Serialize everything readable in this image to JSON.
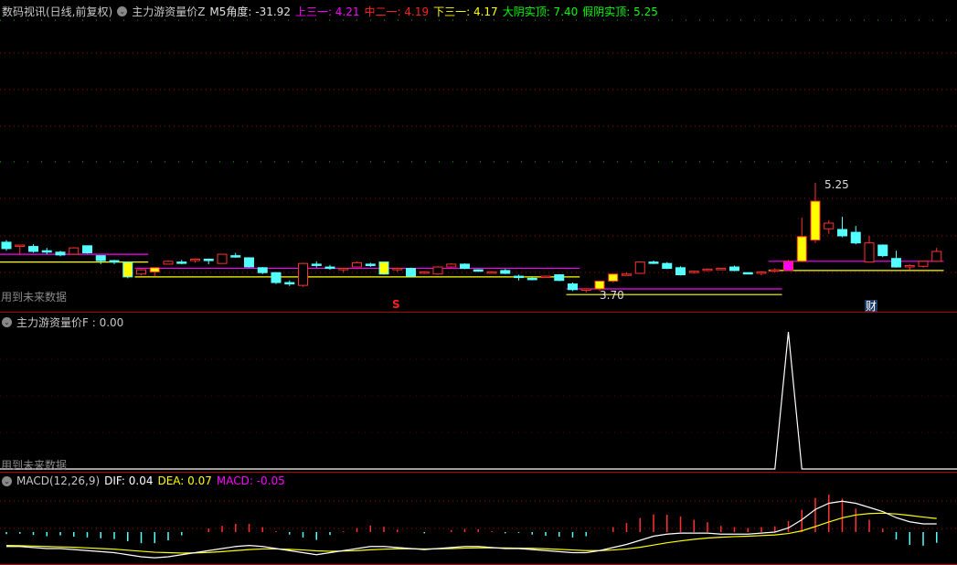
{
  "main_panel": {
    "title": "数码视讯(日线,前复权)",
    "indicator": "主力游资量价Z",
    "m5_angle": "M5角度: -31.92",
    "upper": "上三一: 4.21",
    "middle": "中二一: 4.19",
    "lower": "下三一: 4.17",
    "big_yin": "大阴实顶: 7.40",
    "fake_yin": "假阴实顶: 5.25",
    "future_warning": "用到未来数据",
    "high_label": "5.25",
    "low_label": "3.70",
    "marker_s": "S",
    "marker_cai": "财",
    "colors": {
      "up": "#ff3030",
      "down": "#54ffff",
      "upper": "#ff00ff",
      "middle": "#ff2020",
      "lower": "#ffff00",
      "big_yin": "#00ff00",
      "fake_yin": "#00ff00"
    }
  },
  "sub_panel": {
    "title": "主力游资量价F : 0.00",
    "future_warning": "用到未来数据"
  },
  "macd_panel": {
    "title": "MACD(12,26,9)",
    "dif": "DIF: 0.04",
    "dea": "DEA: 0.07",
    "macd": "MACD: -0.05"
  },
  "chart_data": [
    {
      "type": "candlestick",
      "name": "price",
      "ylim": [
        3.44,
        7.64
      ],
      "candles": [
        [
          4.41,
          4.32,
          4.44,
          4.29
        ],
        [
          4.37,
          4.37,
          4.37,
          4.24
        ],
        [
          4.35,
          4.28,
          4.38,
          4.26
        ],
        [
          4.29,
          4.27,
          4.33,
          4.24
        ],
        [
          4.27,
          4.23,
          4.29,
          4.21
        ],
        [
          4.24,
          4.33,
          4.34,
          4.24
        ],
        [
          4.36,
          4.26,
          4.36,
          4.25
        ],
        [
          4.22,
          4.15,
          4.22,
          4.1
        ],
        [
          4.15,
          4.13,
          4.16,
          4.1
        ],
        [
          4.13,
          3.92,
          4.14,
          3.9
        ],
        [
          3.96,
          4.02,
          4.03,
          3.94
        ],
        [
          3.99,
          4.05,
          4.05,
          3.93
        ],
        [
          4.1,
          4.14,
          4.15,
          4.1
        ],
        [
          4.13,
          4.12,
          4.16,
          4.1
        ],
        [
          4.15,
          4.17,
          4.18,
          4.12
        ],
        [
          4.17,
          4.15,
          4.18,
          4.1
        ],
        [
          4.11,
          4.24,
          4.24,
          4.11
        ],
        [
          4.22,
          4.2,
          4.26,
          4.19
        ],
        [
          4.19,
          4.06,
          4.19,
          4.05
        ],
        [
          4.05,
          3.98,
          4.06,
          3.96
        ],
        [
          3.98,
          3.84,
          3.99,
          3.82
        ],
        [
          3.84,
          3.82,
          3.87,
          3.79
        ],
        [
          3.8,
          4.11,
          4.12,
          3.78
        ],
        [
          4.1,
          4.09,
          4.14,
          4.05
        ],
        [
          4.06,
          4.04,
          4.09,
          4.02
        ],
        [
          4.04,
          4.04,
          4.05,
          3.98
        ],
        [
          4.06,
          4.12,
          4.14,
          4.06
        ],
        [
          4.1,
          4.08,
          4.12,
          4.06
        ],
        [
          4.13,
          3.96,
          4.13,
          3.95
        ],
        [
          4.04,
          4.04,
          4.05,
          3.99
        ],
        [
          4.04,
          3.93,
          4.05,
          3.92
        ],
        [
          3.97,
          3.99,
          4.0,
          3.96
        ],
        [
          3.96,
          4.06,
          4.07,
          3.95
        ],
        [
          4.06,
          4.1,
          4.11,
          4.05
        ],
        [
          4.1,
          4.04,
          4.11,
          4.03
        ],
        [
          4.02,
          4.0,
          4.03,
          3.99
        ],
        [
          3.98,
          3.99,
          4.0,
          3.97
        ],
        [
          4.01,
          3.97,
          4.03,
          3.96
        ],
        [
          3.93,
          3.92,
          3.95,
          3.87
        ],
        [
          3.9,
          3.89,
          3.91,
          3.87
        ],
        [
          3.92,
          3.93,
          3.94,
          3.91
        ],
        [
          3.95,
          3.87,
          3.96,
          3.86
        ],
        [
          3.82,
          3.74,
          3.84,
          3.72
        ],
        [
          3.74,
          3.75,
          3.76,
          3.7
        ],
        [
          3.75,
          3.86,
          3.86,
          3.72
        ],
        [
          3.86,
          3.96,
          3.96,
          3.84
        ],
        [
          3.96,
          3.96,
          3.98,
          3.95
        ],
        [
          3.97,
          4.13,
          4.14,
          3.96
        ],
        [
          4.13,
          4.12,
          4.15,
          4.1
        ],
        [
          4.11,
          4.04,
          4.13,
          4.03
        ],
        [
          4.05,
          3.95,
          4.07,
          3.94
        ],
        [
          3.99,
          4.0,
          4.01,
          3.97
        ],
        [
          4.01,
          4.03,
          4.04,
          4.0
        ],
        [
          4.03,
          4.04,
          4.05,
          4.02
        ],
        [
          4.06,
          4.01,
          4.08,
          4.0
        ],
        [
          3.98,
          3.97,
          3.98,
          3.97
        ],
        [
          3.97,
          3.99,
          4.0,
          3.94
        ],
        [
          4.01,
          4.02,
          4.04,
          3.98
        ],
        [
          4.01,
          4.14,
          4.16,
          4.01
        ],
        [
          4.14,
          4.49,
          4.76,
          4.13
        ],
        [
          4.44,
          4.99,
          5.25,
          4.4
        ],
        [
          4.6,
          4.68,
          4.72,
          4.53
        ],
        [
          4.59,
          4.5,
          4.77,
          4.48
        ],
        [
          4.55,
          4.4,
          4.64,
          4.38
        ],
        [
          4.13,
          4.4,
          4.5,
          4.13
        ],
        [
          4.37,
          4.22,
          4.38,
          4.2
        ],
        [
          4.18,
          4.06,
          4.29,
          4.05
        ],
        [
          4.07,
          4.08,
          4.1,
          4.02
        ],
        [
          4.07,
          4.14,
          4.14,
          4.05
        ],
        [
          4.14,
          4.28,
          4.33,
          4.14
        ]
      ],
      "highlight_yellow": [
        9,
        11,
        28,
        44,
        45,
        59,
        60
      ],
      "highlight_magenta": [
        58
      ],
      "levels": [
        {
          "value": 4.24,
          "color": "#ff00ff",
          "from": 0,
          "to": 11
        },
        {
          "value": 4.13,
          "color": "#ffff00",
          "from": 0,
          "to": 11
        },
        {
          "value": 4.04,
          "color": "#ff00ff",
          "from": 10,
          "to": 43
        },
        {
          "value": 3.92,
          "color": "#ffff00",
          "from": 10,
          "to": 43
        },
        {
          "value": 3.75,
          "color": "#ff00ff",
          "from": 42,
          "to": 58
        },
        {
          "value": 3.67,
          "color": "#ffff00",
          "from": 42,
          "to": 58
        },
        {
          "value": 4.14,
          "color": "#ff00ff",
          "from": 57,
          "to": 70
        },
        {
          "value": 4.01,
          "color": "#ffff00",
          "from": 57,
          "to": 70
        }
      ]
    },
    {
      "type": "line",
      "name": "主力游资量价F",
      "ylim": [
        0,
        1
      ],
      "spike_index": 58,
      "spike_value": 1
    },
    {
      "type": "macd",
      "ylim": [
        -0.16,
        0.24
      ],
      "dif": [
        -0.07,
        -0.07,
        -0.075,
        -0.08,
        -0.08,
        -0.085,
        -0.09,
        -0.095,
        -0.1,
        -0.11,
        -0.12,
        -0.125,
        -0.12,
        -0.11,
        -0.1,
        -0.09,
        -0.08,
        -0.07,
        -0.065,
        -0.07,
        -0.08,
        -0.09,
        -0.1,
        -0.11,
        -0.1,
        -0.09,
        -0.08,
        -0.07,
        -0.07,
        -0.075,
        -0.08,
        -0.085,
        -0.08,
        -0.075,
        -0.07,
        -0.07,
        -0.075,
        -0.08,
        -0.08,
        -0.085,
        -0.09,
        -0.095,
        -0.1,
        -0.1,
        -0.09,
        -0.075,
        -0.06,
        -0.04,
        -0.02,
        -0.01,
        -0.005,
        -0.005,
        -0.005,
        -0.01,
        -0.01,
        -0.01,
        -0.005,
        0.0,
        0.02,
        0.06,
        0.11,
        0.14,
        0.15,
        0.14,
        0.12,
        0.1,
        0.07,
        0.05,
        0.04,
        0.04
      ],
      "dea": [
        -0.065,
        -0.066,
        -0.068,
        -0.07,
        -0.072,
        -0.074,
        -0.077,
        -0.08,
        -0.083,
        -0.088,
        -0.093,
        -0.098,
        -0.1,
        -0.102,
        -0.101,
        -0.099,
        -0.095,
        -0.09,
        -0.085,
        -0.082,
        -0.082,
        -0.084,
        -0.087,
        -0.091,
        -0.093,
        -0.092,
        -0.09,
        -0.086,
        -0.083,
        -0.081,
        -0.081,
        -0.082,
        -0.081,
        -0.08,
        -0.078,
        -0.077,
        -0.077,
        -0.077,
        -0.078,
        -0.079,
        -0.081,
        -0.084,
        -0.087,
        -0.09,
        -0.09,
        -0.087,
        -0.082,
        -0.074,
        -0.063,
        -0.052,
        -0.043,
        -0.035,
        -0.029,
        -0.025,
        -0.022,
        -0.02,
        -0.017,
        -0.014,
        -0.007,
        0.006,
        0.027,
        0.049,
        0.069,
        0.083,
        0.09,
        0.092,
        0.088,
        0.081,
        0.073,
        0.066
      ]
    }
  ]
}
